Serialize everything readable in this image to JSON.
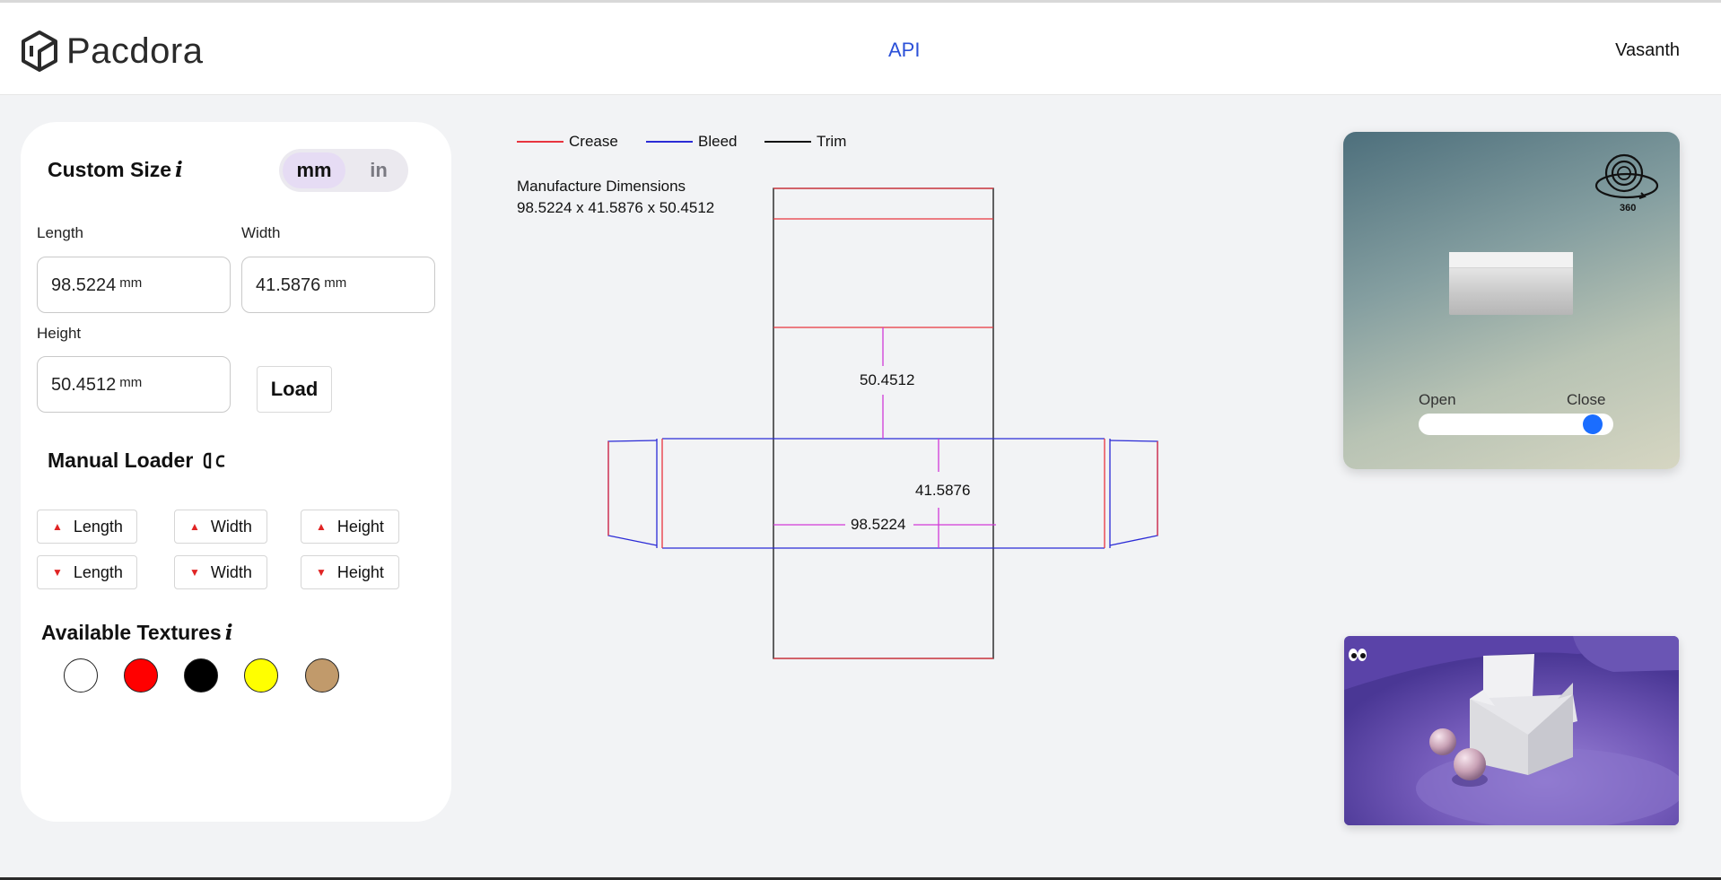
{
  "header": {
    "brand": "Pacdora",
    "nav_api": "API",
    "user": "Vasanth"
  },
  "custom_size": {
    "title": "Custom Size",
    "info_icon": "i",
    "units": [
      "mm",
      "in"
    ],
    "selected_unit": "mm",
    "length_label": "Length",
    "length_value": "98.5224",
    "width_label": "Width",
    "width_value": "41.5876",
    "height_label": "Height",
    "height_value": "50.4512",
    "unit_suffix": "mm",
    "load_label": "Load"
  },
  "manual_loader": {
    "title": "Manual Loader",
    "increase": [
      "Length",
      "Width",
      "Height"
    ],
    "decrease": [
      "Length",
      "Width",
      "Height"
    ]
  },
  "textures": {
    "title": "Available Textures",
    "info_icon": "i",
    "colors": [
      "#ffffff",
      "#ff0000",
      "#000000",
      "#ffff00",
      "#c19a6b"
    ]
  },
  "legend": [
    {
      "label": "Crease",
      "color": "#e8343f"
    },
    {
      "label": "Bleed",
      "color": "#2b2bd6"
    },
    {
      "label": "Trim",
      "color": "#111111"
    }
  ],
  "dimensions": {
    "label": "Manufacture Dimensions",
    "value": "98.5224 x 41.5876 x 50.4512",
    "height_mark": "50.4512",
    "width_mark": "41.5876",
    "length_mark": "98.5224"
  },
  "viewer": {
    "badge_360": "360",
    "open_label": "Open",
    "close_label": "Close",
    "slider_level": 0.9
  },
  "colors": {
    "accent": "#2b50d8",
    "slider": "#1a6dff",
    "crease": "#e8343f",
    "bleed": "#2b2bd6",
    "dim_mark": "#d13ad8"
  }
}
